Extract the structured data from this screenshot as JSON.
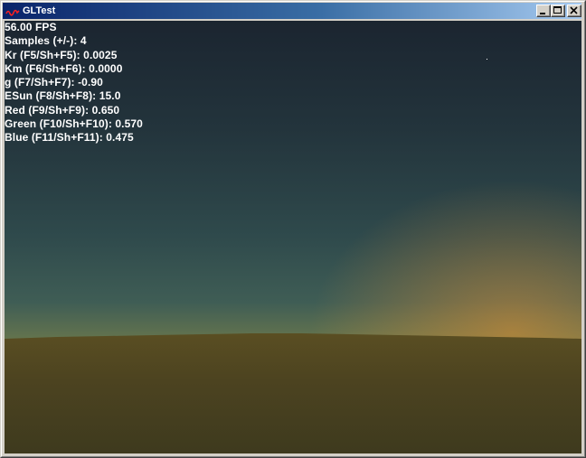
{
  "window": {
    "title": "GLTest",
    "controls": {
      "minimize_icon": "minimize-icon",
      "maximize_icon": "maximize-icon",
      "close_icon": "close-icon"
    }
  },
  "hud": {
    "lines": [
      "56.00 FPS",
      "Samples (+/-): 4",
      "Kr (F5/Sh+F5): 0.0025",
      "Km (F6/Sh+F6): 0.0000",
      "g (F7/Sh+F7): -0.90",
      "ESun (F8/Sh+F8): 15.0",
      "Red (F9/Sh+F9): 0.650",
      "Green (F10/Sh+F10): 0.570",
      "Blue (F11/Sh+F11): 0.475"
    ]
  },
  "colors": {
    "titlebar_start": "#0a246a",
    "titlebar_end": "#a6caf0",
    "sky_top": "#1b2530",
    "sky_mid": "#3a5f5c",
    "horizon_glow": "#d0a430",
    "ground": "#4a4220",
    "hud_text": "#ffffff"
  }
}
